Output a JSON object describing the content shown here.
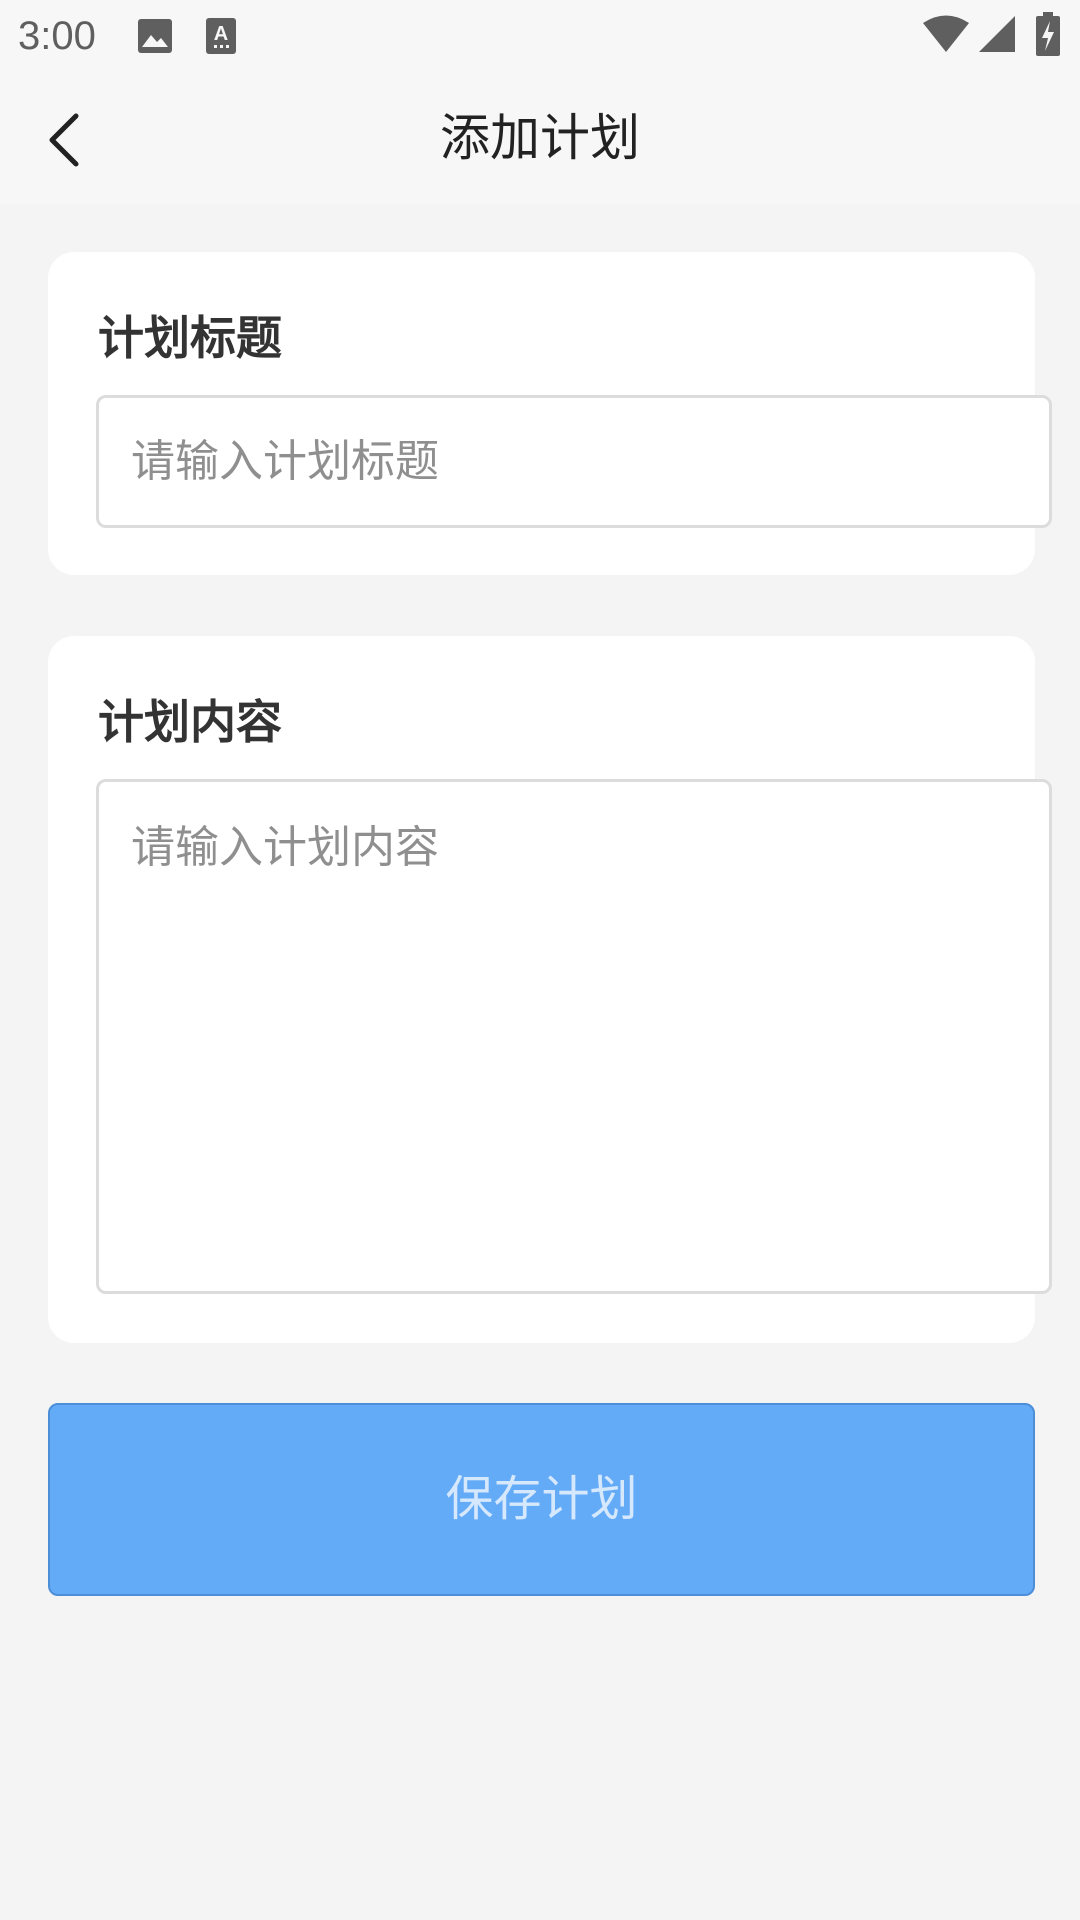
{
  "status_bar": {
    "time": "3:00",
    "icons": [
      "image-icon",
      "font-icon",
      "wifi-icon",
      "cellular-signal-icon",
      "battery-charging-icon"
    ]
  },
  "header": {
    "title": "添加计划",
    "back_icon": "chevron-left-icon"
  },
  "form": {
    "title_section": {
      "label": "计划标题",
      "placeholder": "请输入计划标题",
      "value": ""
    },
    "content_section": {
      "label": "计划内容",
      "placeholder": "请输入计划内容",
      "value": ""
    }
  },
  "actions": {
    "save_label": "保存计划"
  },
  "colors": {
    "background": "#f4f4f4",
    "card": "#ffffff",
    "button": "#63aaf7",
    "button_text": "#d5e8fd"
  }
}
